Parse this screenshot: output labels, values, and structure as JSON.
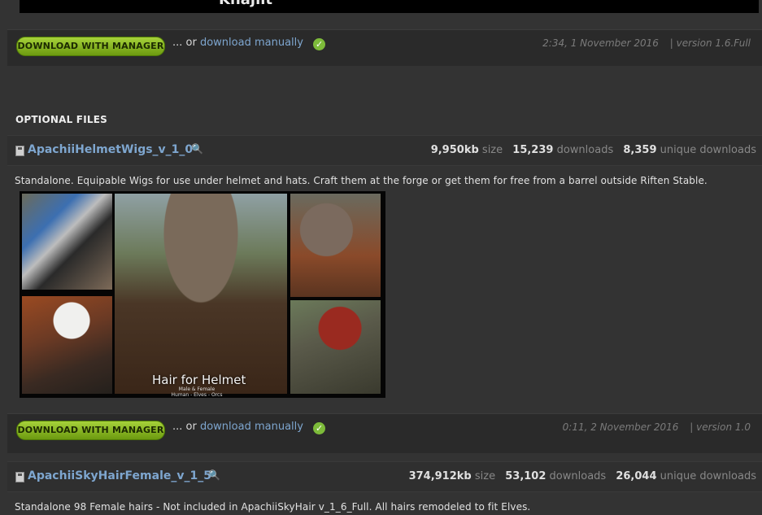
{
  "top_banner": {
    "text": "Khajiit"
  },
  "main_download": {
    "button_label": "DOWNLOAD WITH MANAGER",
    "or_text": "... or",
    "manual_link": "download manually",
    "timestamp": "2:34, 1 November 2016",
    "version": "| version 1.6.Full"
  },
  "optional_files": {
    "section_title": "OPTIONAL FILES",
    "files": [
      {
        "name": "ApachiiHelmetWigs_v_1_0",
        "size_value": "9,950kb",
        "size_label": "size",
        "downloads_value": "15,239",
        "downloads_label": "downloads",
        "unique_value": "8,359",
        "unique_label": "unique downloads",
        "description": "Standalone. Equipable Wigs for use under helmet and hats. Craft them at the forge or get them for free from a barrel outside Riften Stable.",
        "image_title": "Hair for Helmet",
        "image_subtitle": "Male & Female",
        "image_subtitle2": "Human - Elves - Orcs",
        "download": {
          "button_label": "DOWNLOAD WITH MANAGER",
          "or_text": "... or",
          "manual_link": "download manually",
          "timestamp": "0:11, 2 November 2016",
          "version": "| version 1.0"
        }
      },
      {
        "name": "ApachiiSkyHairFemale_v_1_5",
        "size_value": "374,912kb",
        "size_label": "size",
        "downloads_value": "53,102",
        "downloads_label": "downloads",
        "unique_value": "26,044",
        "unique_label": "unique downloads",
        "description": "Standalone 98 Female hairs - Not included in ApachiiSkyHair v_1_6_Full. All hairs remodeled to fit Elves."
      }
    ]
  },
  "colors": {
    "background": "#333333",
    "link": "#7ea6cf",
    "button_green": "#8cbf24"
  }
}
